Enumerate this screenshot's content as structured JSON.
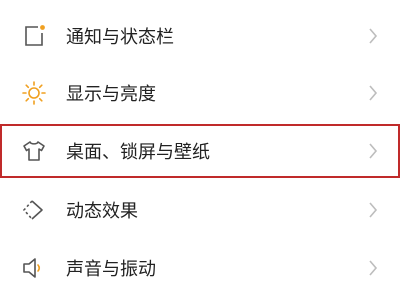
{
  "accent_color": "#f0a020",
  "highlight_color": "#c02a2a",
  "settings": {
    "items": [
      {
        "label": "通知与状态栏",
        "icon": "notification-square-icon",
        "highlighted": false
      },
      {
        "label": "显示与亮度",
        "icon": "sun-brightness-icon",
        "highlighted": false
      },
      {
        "label": "桌面、锁屏与壁纸",
        "icon": "tshirt-theme-icon",
        "highlighted": true
      },
      {
        "label": "动态效果",
        "icon": "motion-effect-icon",
        "highlighted": false
      },
      {
        "label": "声音与振动",
        "icon": "speaker-icon",
        "highlighted": false
      }
    ]
  }
}
